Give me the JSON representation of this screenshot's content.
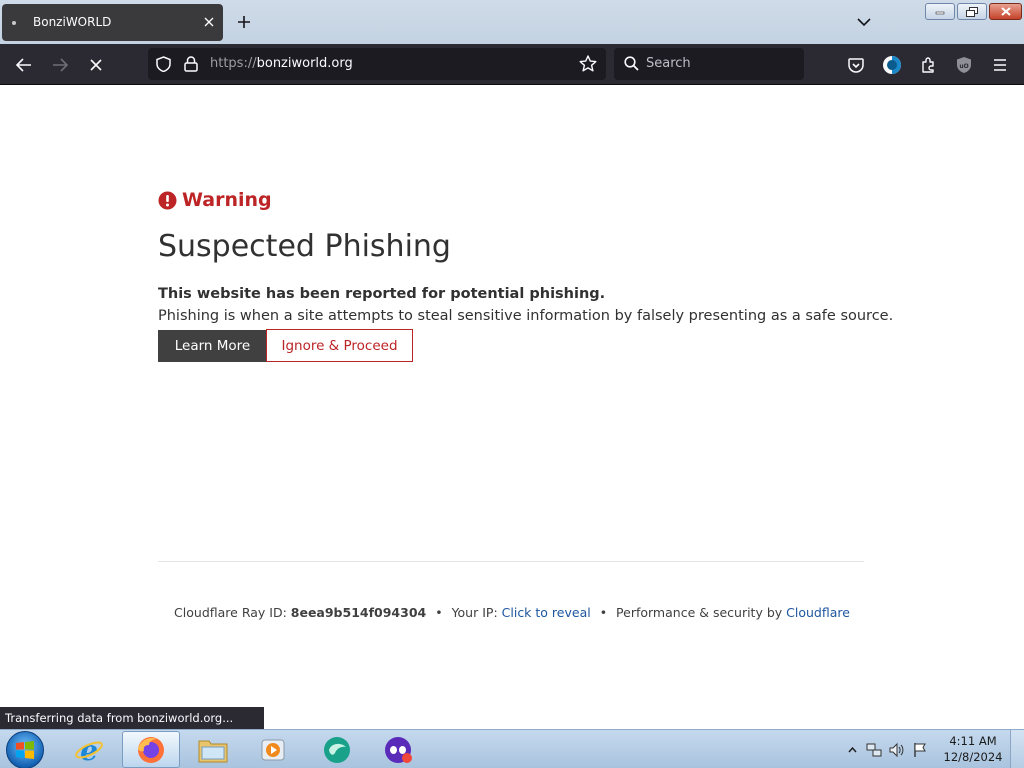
{
  "browser": {
    "tab": {
      "title": "BonziWORLD"
    },
    "url": {
      "scheme": "https://",
      "host": "bonziworld.org"
    },
    "search": {
      "placeholder": "Search"
    }
  },
  "page": {
    "warning_label": "Warning",
    "title": "Suspected Phishing",
    "description_bold": "This website has been reported for potential phishing.",
    "description": "Phishing is when a site attempts to steal sensitive information by falsely presenting as a safe source.",
    "learn_more_label": "Learn More",
    "ignore_label": "Ignore & Proceed",
    "footer": {
      "ray_label": "Cloudflare Ray ID:",
      "ray_id": "8eea9b514f094304",
      "ip_label": "Your IP:",
      "ip_link": "Click to reveal",
      "perf_label": "Performance & security by",
      "perf_link": "Cloudflare",
      "separator": "•"
    }
  },
  "status": {
    "text": "Transferring data from bonziworld.org..."
  },
  "taskbar": {
    "clock_time": "4:11 AM",
    "clock_date": "12/8/2024",
    "apps": [
      "internet-explorer",
      "firefox",
      "file-explorer",
      "media-player",
      "app-teal",
      "app-purple"
    ]
  },
  "colors": {
    "warning_red": "#bd2426",
    "link_blue": "#1e56a0",
    "toolbar_dark": "#2b2a33"
  }
}
